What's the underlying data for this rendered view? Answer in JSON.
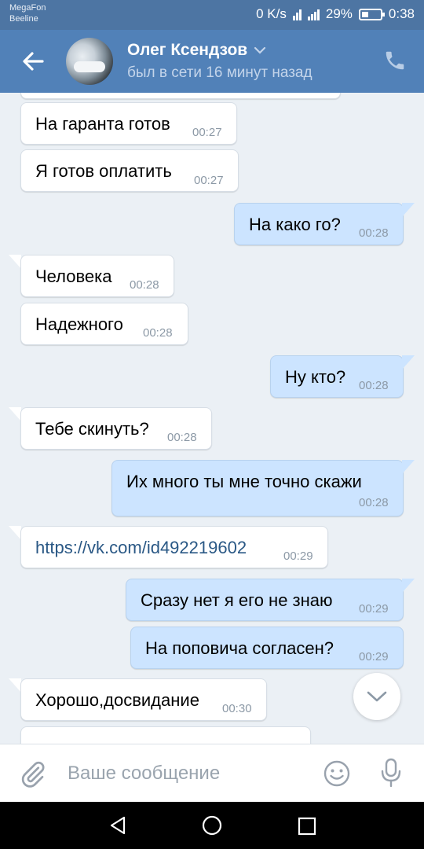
{
  "status_bar": {
    "carrier_1": "MegaFon",
    "carrier_2": "Beeline",
    "speed": "0 K/s",
    "battery": "29%",
    "time": "0:38"
  },
  "header": {
    "contact_name": "Олег Ксендзов",
    "last_seen": "был в сети 16 минут назад"
  },
  "messages": [
    {
      "dir": "in",
      "text": "На гаранта готов",
      "time": "00:27"
    },
    {
      "dir": "in",
      "text": "Я готов оплатить",
      "time": "00:27"
    },
    {
      "dir": "out",
      "text": "На како го?",
      "time": "00:28"
    },
    {
      "dir": "in",
      "text": "Человека",
      "time": "00:28"
    },
    {
      "dir": "in",
      "text": "Надежного",
      "time": "00:28"
    },
    {
      "dir": "out",
      "text": "Ну кто?",
      "time": "00:28"
    },
    {
      "dir": "in",
      "text": "Тебе скинуть?",
      "time": "00:28"
    },
    {
      "dir": "out",
      "text": "Их много ты мне точно скажи",
      "time": "00:28"
    },
    {
      "dir": "in",
      "text": "https://vk.com/id492219602",
      "time": "00:29"
    },
    {
      "dir": "out",
      "text": "Сразу нет я его не знаю",
      "time": "00:29"
    },
    {
      "dir": "out",
      "text": "На поповича согласен?",
      "time": "00:29"
    },
    {
      "dir": "in",
      "text": "Хорошо,досвидание",
      "time": "00:30"
    }
  ],
  "composer": {
    "placeholder": "Ваше сообщение"
  },
  "colors": {
    "header": "#5181b8",
    "statusbar": "#4d75a3",
    "incoming_bubble": "#ffffff",
    "outgoing_bubble": "#cce4ff",
    "background": "#ebf0f5",
    "link": "#2a5885"
  },
  "icons": {
    "back": "arrow-left-icon",
    "call": "phone-icon",
    "more": "chevron-down-icon",
    "attach": "paperclip-icon",
    "emoji": "smiley-icon",
    "mic": "microphone-icon",
    "scroll": "chevron-down-icon"
  }
}
